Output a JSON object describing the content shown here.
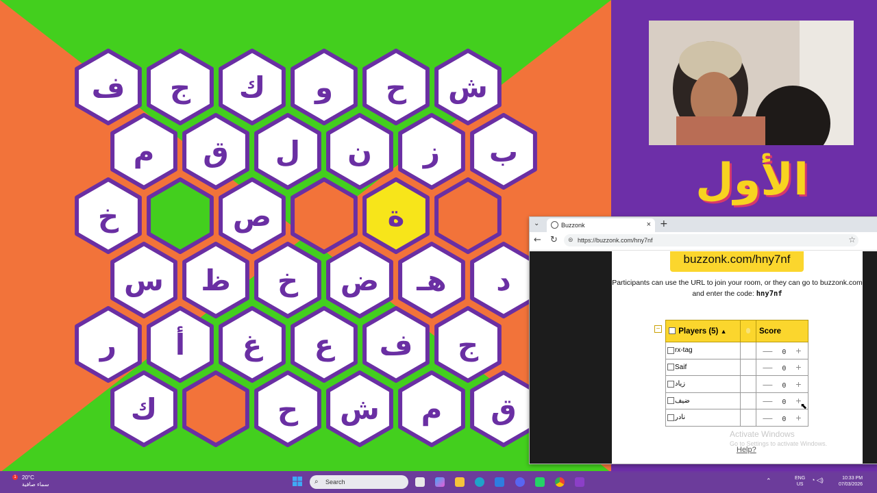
{
  "board": {
    "rows": [
      [
        "ف",
        "ج",
        "ك",
        "و",
        "ح",
        "ش"
      ],
      [
        "م",
        "ق",
        "ل",
        "ن",
        "ز",
        "ب"
      ],
      [
        "خ",
        "",
        "ص",
        "",
        "ة",
        ""
      ],
      [
        "س",
        "ظ",
        "خ",
        "ض",
        "هـ",
        "د"
      ],
      [
        "ر",
        "أ",
        "غ",
        "ع",
        "ف",
        "ج"
      ],
      [
        "ك",
        "",
        "ح",
        "ش",
        "م",
        "ق"
      ]
    ],
    "special_cells": {
      "2-1": "green",
      "2-3": "orange",
      "2-4": "yellow",
      "2-5": "orange",
      "5-1": "orange"
    },
    "colors": {
      "border": "#6a2fa3",
      "cell": "#ffffff",
      "green": "#43cf1e",
      "orange": "#f2733a",
      "yellow": "#f7e51a"
    }
  },
  "background_colors": {
    "green": "#43cf1e",
    "orange": "#f2733a",
    "purple": "#6d2fa8"
  },
  "browser": {
    "tab_title": "Buzzonk",
    "url": "https://buzzonk.com/hny7nf",
    "room_url": "buzzonk.com/hny7nf",
    "join_text": "Participants can use the URL to join your room, or they can go to buzzonk.com and enter the code:",
    "join_code": "hny7nf",
    "table": {
      "players_header": "Players (5)",
      "sort_icon": "▲",
      "score_header": "Score",
      "players": [
        {
          "name": "rx-tag",
          "score": "0"
        },
        {
          "name": "Saif",
          "score": "0"
        },
        {
          "name": "زياد",
          "score": "0"
        },
        {
          "name": "ضيف",
          "score": "0"
        },
        {
          "name": "نادر",
          "score": "0"
        }
      ]
    },
    "activate_title": "Activate Windows",
    "activate_sub": "Go to Settings to activate Windows.",
    "help_link": "Help?"
  },
  "promo_text": "الأول",
  "taskbar": {
    "weather_temp": "20°C",
    "weather_desc": "سماء صافية",
    "weather_badge": "1",
    "search_placeholder": "Search",
    "lang_top": "ENG",
    "lang_bottom": "US",
    "time": "10:33 PM",
    "date": "07/03/2026"
  }
}
